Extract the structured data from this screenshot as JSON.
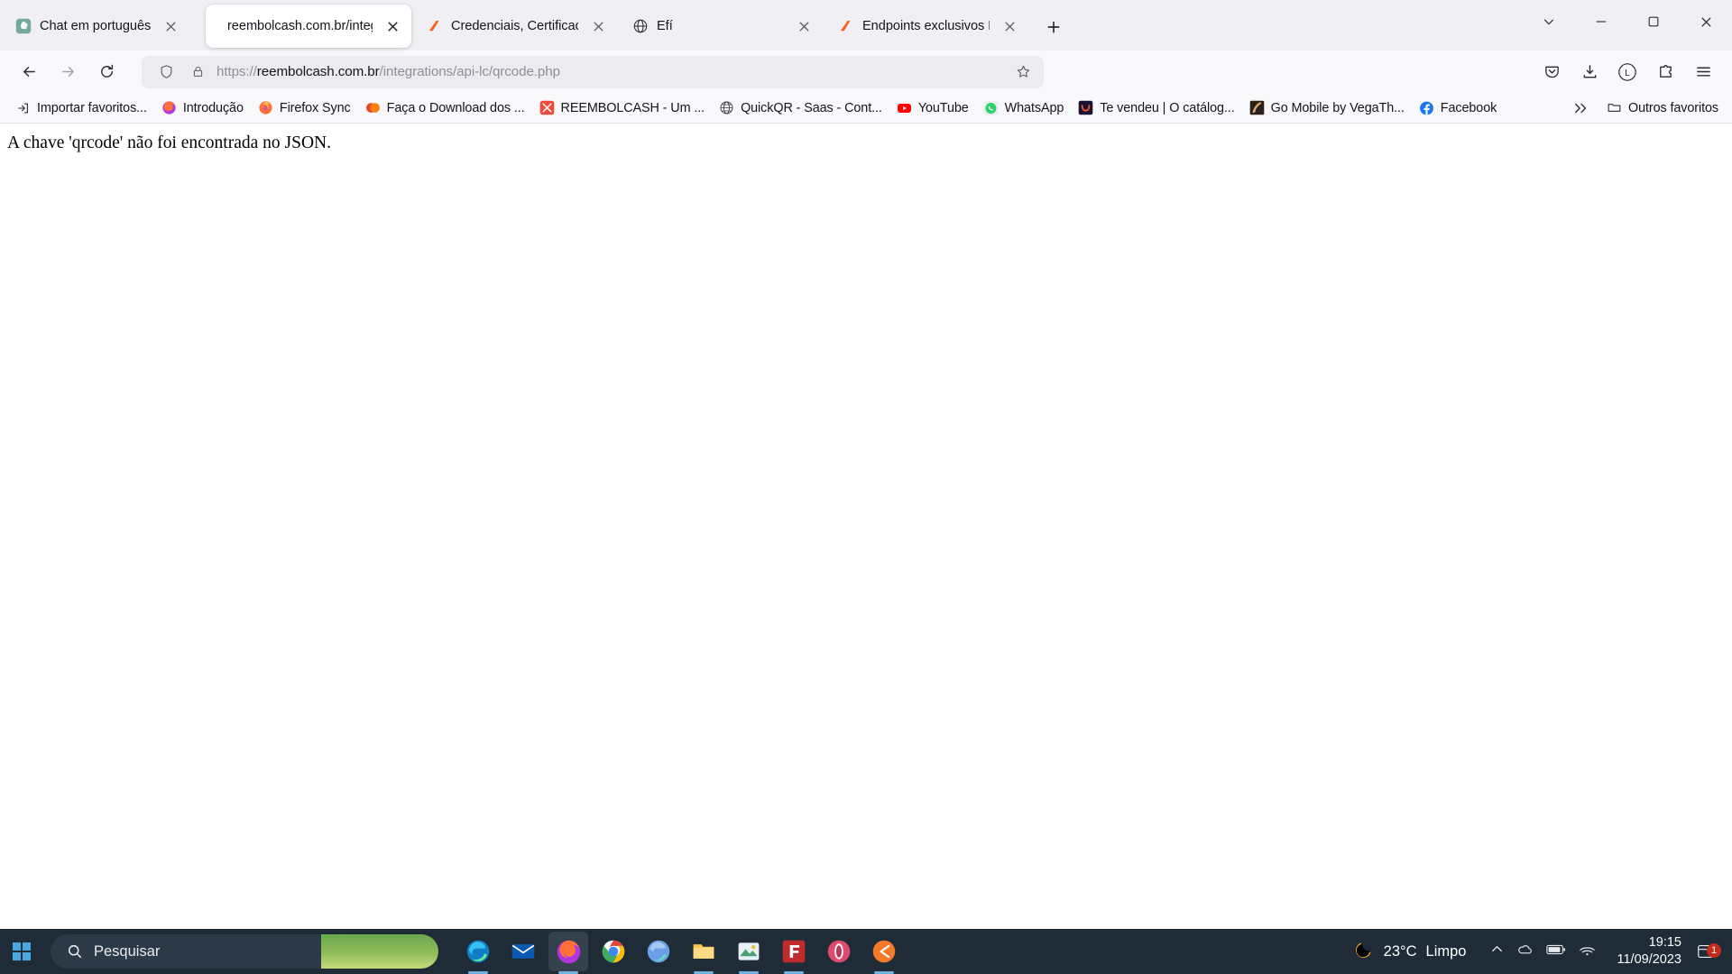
{
  "window": {
    "controls": {
      "list_all_tabs": "v",
      "minimize": "—",
      "maximize": "□",
      "close": "✕"
    }
  },
  "tabs": [
    {
      "title": "Chat em português",
      "icon": "chatgpt-icon",
      "active": false,
      "close_label": "✕"
    },
    {
      "title": "reembolcash.com.br/integrations/api-lc/qrcode.php",
      "icon": "generic-page-icon",
      "active": true,
      "close_label": "✕"
    },
    {
      "title": "Credenciais, Certificado e Autorização",
      "icon": "efi-icon",
      "active": false,
      "close_label": "✕"
    },
    {
      "title": "Efí",
      "icon": "globe-icon",
      "active": false,
      "close_label": "✕"
    },
    {
      "title": "Endpoints exclusivos Efí | Documentação",
      "icon": "efi-icon",
      "active": false,
      "close_label": "✕"
    }
  ],
  "newtab_label": "+",
  "nav": {
    "back": "Voltar",
    "forward": "Avançar",
    "reload": "Recarregar"
  },
  "urlbar": {
    "scheme": "https://",
    "host": "reembolcash.com.br",
    "path": "/integrations/api-lc/qrcode.php",
    "full_url": "https://reembolcash.com.br/integrations/api-lc/qrcode.php",
    "shield_title": "Proteções",
    "lock_title": "Conexão segura",
    "bookmark_title": "Adicionar aos favoritos"
  },
  "toolbar_right": {
    "pocket": "Salvar no Pocket",
    "downloads": "Downloads",
    "account": "L",
    "extensions": "Extensões",
    "menu": "Abrir menu do aplicativo"
  },
  "bookmarks": {
    "items": [
      {
        "label": "Importar favoritos...",
        "icon": "import-icon"
      },
      {
        "label": "Introdução",
        "icon": "firefox-icon"
      },
      {
        "label": "Firefox Sync",
        "icon": "firefox-sync-icon"
      },
      {
        "label": "Faça o Download dos ...",
        "icon": "orange-dot-icon"
      },
      {
        "label": "REEMBOLCASH - Um ...",
        "icon": "reembolcash-icon"
      },
      {
        "label": "QuickQR - Saas - Cont...",
        "icon": "globe-icon"
      },
      {
        "label": "YouTube",
        "icon": "youtube-icon"
      },
      {
        "label": "WhatsApp",
        "icon": "whatsapp-icon"
      },
      {
        "label": "Te vendeu | O catálog...",
        "icon": "tevendeu-icon"
      },
      {
        "label": "Go Mobile by VegaTh...",
        "icon": "gomobile-icon"
      },
      {
        "label": "Facebook",
        "icon": "facebook-icon"
      }
    ],
    "overflow_label": "»",
    "other_folder": "Outros favoritos"
  },
  "page": {
    "message": "A chave 'qrcode' não foi encontrada no JSON."
  },
  "taskbar": {
    "start_label": "Iniciar",
    "search_placeholder": "Pesquisar",
    "apps": [
      {
        "name": "microsoft-edge",
        "running": true
      },
      {
        "name": "mail",
        "running": false
      },
      {
        "name": "firefox",
        "running": true,
        "active": true
      },
      {
        "name": "google-chrome",
        "running": false
      },
      {
        "name": "microsoft-edge-dev",
        "running": false
      },
      {
        "name": "file-explorer",
        "running": true
      },
      {
        "name": "image-viewer",
        "running": true
      },
      {
        "name": "filezilla",
        "running": true
      },
      {
        "name": "opera-gx",
        "running": false
      },
      {
        "name": "sublime-text",
        "running": true
      }
    ],
    "weather": {
      "temperature": "23°C",
      "condition": "Limpo",
      "icon": "moon-icon"
    },
    "tray": {
      "chevron": "^",
      "onedrive": "onedrive-icon",
      "battery": "battery-icon",
      "network": "network-icon"
    },
    "clock": {
      "time": "19:15",
      "date": "11/09/2023"
    },
    "notifications": {
      "icon": "notification-icon",
      "count": "1"
    }
  },
  "colors": {
    "tabstrip_bg": "#f0f0f4",
    "toolbar_bg": "#f9f9fb",
    "urlbar_bg": "#ececf0",
    "accent_orange": "#f26522",
    "taskbar_bg": "#1f2c38",
    "link_blue": "#0b57d0"
  }
}
